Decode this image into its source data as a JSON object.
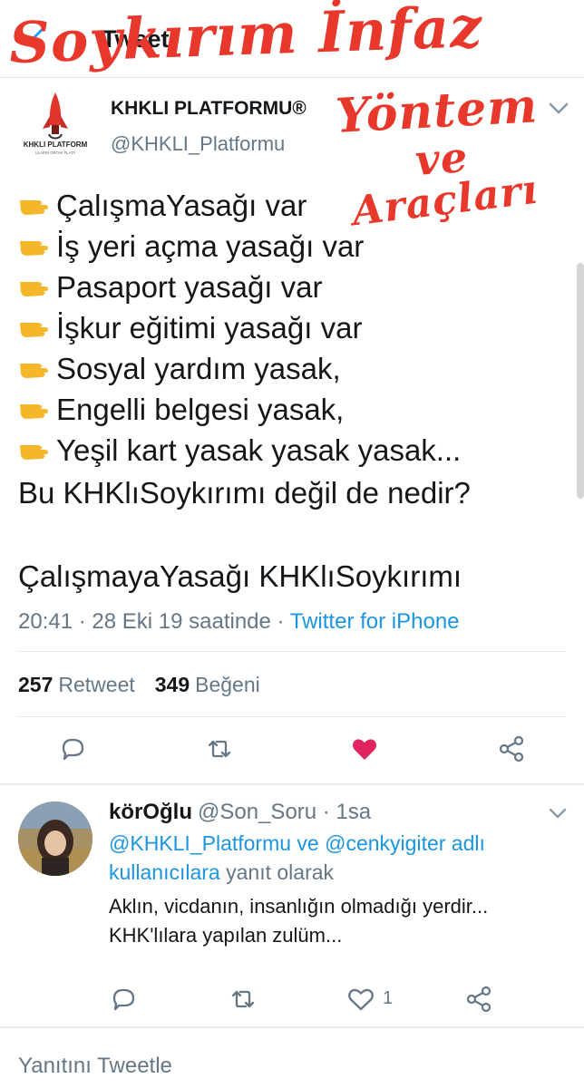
{
  "header": {
    "title": "Tweet"
  },
  "overlay": {
    "line1": "Soykırım İnfaz",
    "line2": "Yöntem",
    "line3": "ve",
    "line4": "Araçları"
  },
  "author": {
    "name": "KHKLI PLATFORMU®",
    "handle": "@KHKLI_Platformu",
    "logo_text": "KHKLI PLATFORM",
    "logo_sub": "ULARIN ORTAK PLATF"
  },
  "tweet": {
    "lines": [
      "ÇalışmaYasağı var",
      "İş yeri açma yasağı var",
      "Pasaport yasağı var",
      "İşkur eğitimi yasağı var",
      "Sosyal yardım yasak,",
      "Engelli belgesi yasak,",
      "Yeşil kart yasak yasak yasak..."
    ],
    "question": "Bu KHKlıSoykırımı değil de nedir?",
    "tags": "ÇalışmayaYasağı KHKlıSoykırımı",
    "timestamp": "20:41 · 28 Eki 19 saatinde · ",
    "source": "Twitter for iPhone"
  },
  "stats": {
    "retweets": "257",
    "retweet_label": "Retweet",
    "likes": "349",
    "like_label": "Beğeni"
  },
  "actions": {
    "reply_icon": "reply-icon",
    "retweet_icon": "retweet-icon",
    "like_icon": "heart-filled-icon",
    "share_icon": "share-icon",
    "like_color": "#e0245e"
  },
  "reply": {
    "name": "körOğlu",
    "handle_time": "@Son_Soru · 1sa",
    "mention1": "@KHKLI_Platformu",
    "ctx_and": " ve ",
    "mention2": "@cenkyigiter adlı kullanıcılara",
    "ctx_suffix": " yanıt olarak",
    "text": "Aklın, vicdanın, insanlığın olmadığı yerdir... KHK'lılara yapılan zulüm...",
    "like_count": "1"
  },
  "composer": {
    "placeholder": "Yanıtını Tweetle"
  }
}
